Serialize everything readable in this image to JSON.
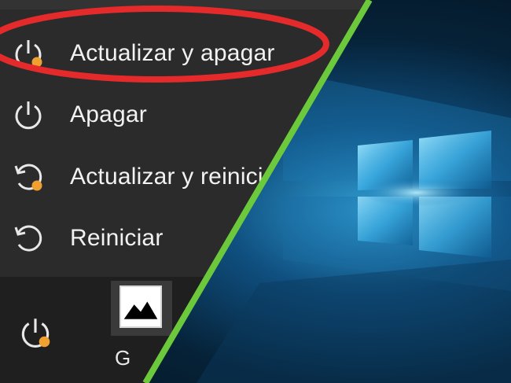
{
  "power_menu": {
    "items": [
      {
        "label": "Actualizar y apagar",
        "icon": "power-update-icon",
        "badge_color": "#f0a030"
      },
      {
        "label": "Apagar",
        "icon": "power-icon"
      },
      {
        "label": "Actualizar y reiniciar",
        "icon": "restart-update-icon",
        "badge_color": "#f0a030"
      },
      {
        "label": "Reiniciar",
        "icon": "restart-icon"
      }
    ],
    "highlighted_item": "Actualizar y apagar"
  },
  "start_strip": {
    "tile_icon": "image-icon",
    "power_icon": "power-update-icon",
    "partial_label": "G"
  },
  "colors": {
    "highlight_ring": "#e42a2a",
    "divider": "#6cc93c",
    "update_badge": "#f0a030"
  }
}
